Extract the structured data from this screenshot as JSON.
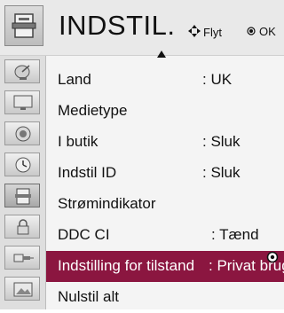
{
  "header": {
    "title": "INDSTIL.",
    "icon": "toolbox-icon",
    "hint_move_icon": "four-way-arrow-icon",
    "hint_move_label": "Flyt",
    "hint_ok_icon": "ok-dot-icon",
    "hint_ok_label": "OK"
  },
  "sidebar": {
    "items": [
      {
        "icon": "satellite-dish-icon"
      },
      {
        "icon": "tv-screen-icon"
      },
      {
        "icon": "speaker-icon"
      },
      {
        "icon": "clock-icon"
      },
      {
        "icon": "toolbox-icon",
        "active": true
      },
      {
        "icon": "lock-icon"
      },
      {
        "icon": "input-plug-icon"
      },
      {
        "icon": "photo-icon"
      }
    ]
  },
  "menu": {
    "items": [
      {
        "label": "Land",
        "value": ": UK"
      },
      {
        "label": "Medietype",
        "value": ""
      },
      {
        "label": "I butik",
        "value": ": Sluk"
      },
      {
        "label": "Indstil ID",
        "value": ": Sluk"
      },
      {
        "label": "Strømindikator",
        "value": ""
      },
      {
        "label": "DDC CI",
        "value": ": Tænd"
      },
      {
        "label": "Indstilling for tilstand",
        "value": ": Privat brug",
        "selected": true
      },
      {
        "label": "Nulstil alt",
        "value": ""
      }
    ]
  },
  "colors": {
    "selected_row": "#8b1640",
    "header_bg": "#e9e9e9",
    "content_bg": "#f4f4f4"
  }
}
